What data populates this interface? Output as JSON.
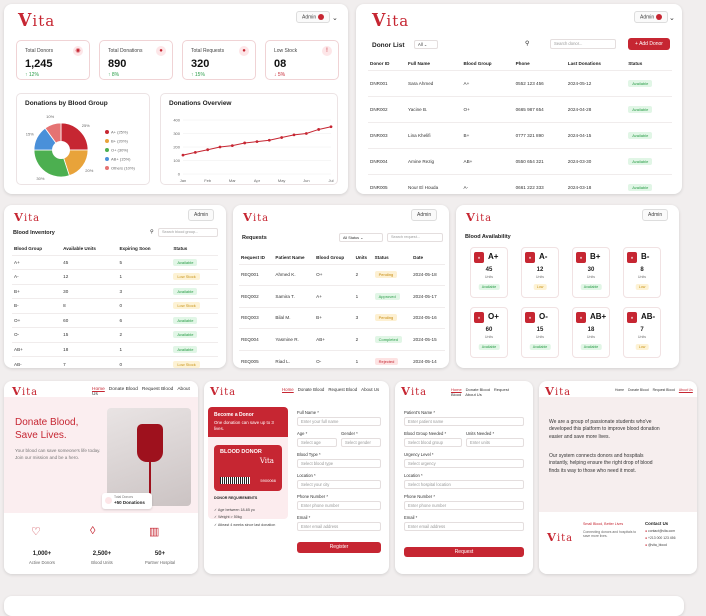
{
  "brand": {
    "logo": "Vita",
    "accent": "#c62632"
  },
  "user": {
    "label": "Admin"
  },
  "dashboard": {
    "cards": [
      {
        "label": "Total Donors",
        "value": "1,245",
        "trend": "12%",
        "dir": "up",
        "icon": "user-icon"
      },
      {
        "label": "Total Donations",
        "value": "890",
        "trend": "8%",
        "dir": "up",
        "icon": "drop-icon"
      },
      {
        "label": "Total Requests",
        "value": "320",
        "trend": "15%",
        "dir": "up",
        "icon": "drop-icon"
      },
      {
        "label": "Low Stock",
        "value": "08",
        "trend": "5%",
        "dir": "down",
        "icon": "alert-icon"
      }
    ],
    "pie_title": "Donations by Blood Group",
    "line_title": "Donations Overview"
  },
  "chart_data": [
    {
      "type": "pie",
      "title": "Donations by Blood Group",
      "slices": [
        {
          "label": "A+",
          "value": 25,
          "color": "#c62632"
        },
        {
          "label": "B+",
          "value": 20,
          "color": "#e8a33a"
        },
        {
          "label": "O+",
          "value": 30,
          "color": "#4caf50"
        },
        {
          "label": "AB+",
          "value": 15,
          "color": "#4a90d9"
        },
        {
          "label": "Others",
          "value": 10,
          "color": "#e57373"
        }
      ],
      "legend": [
        "A+ (25%)",
        "B+ (20%)",
        "O+ (30%)",
        "AB+ (15%)",
        "Others (10%)"
      ],
      "data_labels": [
        "25%",
        "20%",
        "30%",
        "15%",
        "10%"
      ],
      "legend_position": "right"
    },
    {
      "type": "line",
      "title": "Donations Overview",
      "x": [
        "Jan",
        "Feb",
        "Mar",
        "Apr",
        "May",
        "Jun",
        "Jul"
      ],
      "x_points": [
        0,
        0.5,
        1,
        1.5,
        2,
        2.5,
        3,
        3.5,
        4,
        4.5,
        5,
        5.5,
        6
      ],
      "values": [
        140,
        160,
        180,
        200,
        210,
        230,
        240,
        250,
        270,
        290,
        300,
        330,
        350
      ],
      "ylim": [
        0,
        400
      ],
      "yticks": [
        "0",
        "100",
        "200",
        "300",
        "400"
      ],
      "color": "#c62632",
      "grid": true
    }
  ],
  "donors": {
    "title": "Donor List",
    "filter": "All",
    "search_placeholder": "Search donor...",
    "add_label": "+ Add Donor",
    "columns": [
      "Donor ID",
      "Full Name",
      "Blood Group",
      "Phone",
      "Last Donations",
      "Status"
    ],
    "rows": [
      [
        "DNR001",
        "Sara Ahmed",
        "A+",
        "0552 123 456",
        "2024-05-12",
        "Available"
      ],
      [
        "DNR002",
        "Yacine B.",
        "O+",
        "0665 987 654",
        "2024-04-28",
        "Available"
      ],
      [
        "DNR003",
        "Lina Khelifi",
        "B+",
        "0777 321 890",
        "2024-04-15",
        "Available"
      ],
      [
        "DNR004",
        "Amine Rezig",
        "AB+",
        "0550 654 321",
        "2024-03-30",
        "Available"
      ],
      [
        "DNR005",
        "Nour El Houda",
        "A-",
        "0661 222 333",
        "2024-03-18",
        "Available"
      ]
    ]
  },
  "inventory": {
    "title": "Blood Inventory",
    "search_placeholder": "Search blood group...",
    "columns": [
      "Blood Group",
      "Available Units",
      "Expiring Soon",
      "Status"
    ],
    "rows": [
      [
        "A+",
        "45",
        "5",
        "Available"
      ],
      [
        "A-",
        "12",
        "1",
        "Low Stock"
      ],
      [
        "B+",
        "30",
        "3",
        "Available"
      ],
      [
        "B-",
        "8",
        "0",
        "Low Stock"
      ],
      [
        "O+",
        "60",
        "6",
        "Available"
      ],
      [
        "O-",
        "15",
        "2",
        "Available"
      ],
      [
        "AB+",
        "18",
        "1",
        "Available"
      ],
      [
        "AB-",
        "7",
        "0",
        "Low Stock"
      ]
    ]
  },
  "requests": {
    "title": "Requests",
    "filter": "All Status",
    "search_placeholder": "Search request...",
    "columns": [
      "Request ID",
      "Patient Name",
      "Blood Group",
      "Units",
      "Status",
      "Date"
    ],
    "rows": [
      [
        "REQ001",
        "Ahmed K.",
        "O+",
        "2",
        "Pending",
        "2024-05-18"
      ],
      [
        "REQ002",
        "Samira T.",
        "A+",
        "1",
        "Approved",
        "2024-05-17"
      ],
      [
        "REQ003",
        "Bilal M.",
        "B+",
        "3",
        "Pending",
        "2024-05-16"
      ],
      [
        "REQ004",
        "Yasmine R.",
        "AB+",
        "2",
        "Completed",
        "2024-05-15"
      ],
      [
        "REQ005",
        "Riad L.",
        "O-",
        "1",
        "Rejected",
        "2024-05-14"
      ]
    ]
  },
  "availability": {
    "title": "Blood Availability",
    "items": [
      {
        "group": "A+",
        "units": "45",
        "status": "Available"
      },
      {
        "group": "A-",
        "units": "12",
        "status": "Low"
      },
      {
        "group": "B+",
        "units": "30",
        "status": "Available"
      },
      {
        "group": "B-",
        "units": "8",
        "status": "Low"
      },
      {
        "group": "O+",
        "units": "60",
        "status": "Available"
      },
      {
        "group": "O-",
        "units": "15",
        "status": "Available"
      },
      {
        "group": "AB+",
        "units": "18",
        "status": "Available"
      },
      {
        "group": "AB-",
        "units": "7",
        "status": "Low"
      }
    ],
    "units_label": "Units"
  },
  "nav": {
    "home": "Home",
    "donate": "Donate Blood",
    "request": "Request Blood",
    "about": "About Us"
  },
  "landing": {
    "headline_1": "Donate Blood,",
    "headline_2": "Save Lives.",
    "text": "Your blood can save someone's life today. Join our mission and be a hero.",
    "badge_label": "Total Donors",
    "badge_value": "+50 Donations",
    "stats": [
      {
        "value": "1,000+",
        "label": "Active Donors"
      },
      {
        "value": "2,500+",
        "label": "Blood Units"
      },
      {
        "value": "50+",
        "label": "Partner Hospital"
      }
    ]
  },
  "donate_form": {
    "promo_title": "Become a Donor",
    "promo_text": "One donation can save up to 3 lives.",
    "card_label": "BLOOD DONOR",
    "card_logo": "Vita",
    "card_id": "5900066",
    "req_title": "DONOR REQUIREMENTS",
    "reqs": [
      "Age between 18-65 yo",
      "Weight > 50kg",
      "Atleast 4 weeks since last donation"
    ],
    "labels": {
      "name": "Full Name *",
      "age": "Age *",
      "gender": "Gender *",
      "blood": "Blood Type *",
      "location": "Location *",
      "phone": "Phone Number *",
      "email": "Email *"
    },
    "placeholders": {
      "name": "Enter your full name",
      "age": "Select age",
      "gender": "Select gender",
      "blood": "Select blood type",
      "location": "Select your city",
      "phone": "Enter phone number",
      "email": "Enter email address"
    },
    "submit": "Register"
  },
  "request_form": {
    "labels": {
      "patient": "Patient's Name *",
      "group": "Blood Group Needed *",
      "units": "Units Needed *",
      "urgency": "Urgency Level *",
      "location": "Location *",
      "phone": "Phone Number *",
      "email": "Email *"
    },
    "placeholders": {
      "patient": "Enter patient name",
      "group": "Select blood group",
      "units": "Enter units",
      "urgency": "Select urgency",
      "location": "Select hospital location",
      "phone": "Enter phone number",
      "email": "Enter email address"
    },
    "submit": "Request"
  },
  "about": {
    "text_1": "We are a group of passionate students who've developed this platform to improve blood donation easier and save more lives.",
    "text_2": "Our system connects donors and hospitals instantly, helping ensure the right drop of blood finds its way to those who need it most.",
    "tagline": "Small Blood, Better Lives",
    "footer_text": "Connecting donors and hospitals to save more lives.",
    "contact_title": "Contact Us",
    "contacts": [
      "contact@vita.com",
      "+213 000 123 456",
      "@vita_blood"
    ]
  }
}
